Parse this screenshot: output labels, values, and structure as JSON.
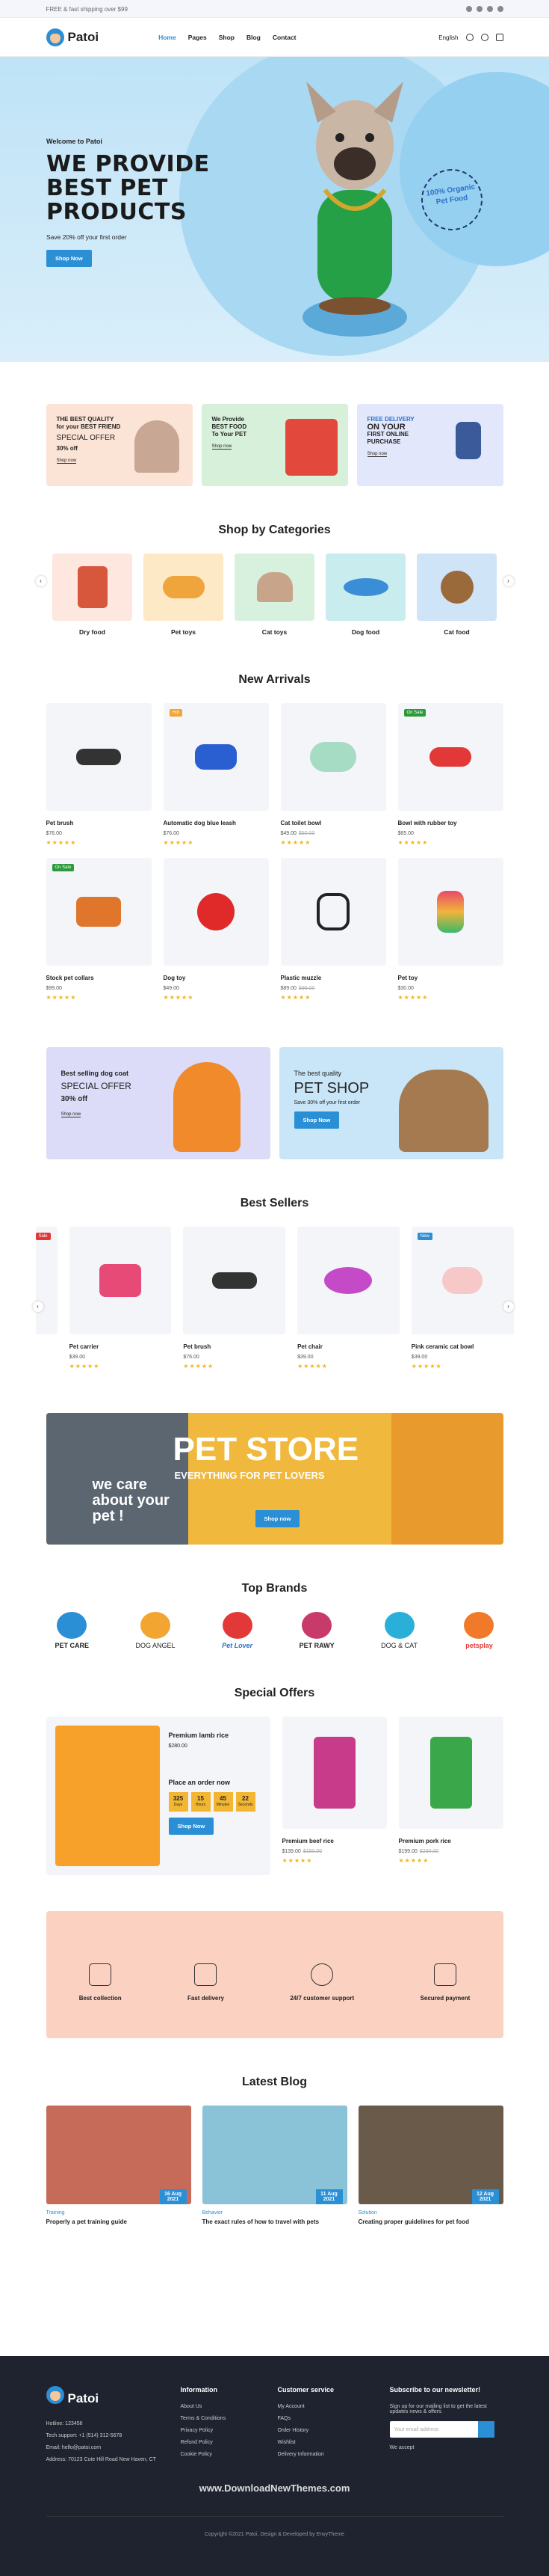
{
  "topbar": {
    "shipping": "FREE & fast shipping over $99"
  },
  "header": {
    "brand": "Patoi",
    "nav": [
      "Home",
      "Pages",
      "Shop",
      "Blog",
      "Contact"
    ],
    "lang": "English"
  },
  "hero": {
    "welcome": "Welcome to Patoi",
    "title": "We provide best pet products",
    "save": "Save 20% off your first order",
    "button": "Shop Now",
    "badge": "100% Organic Pet Food"
  },
  "promos": [
    {
      "l1": "THE BEST QUALITY",
      "l2": "for your BEST FRIEND",
      "l3": "SPECIAL OFFER",
      "l4": "30% off",
      "link": "Shop now"
    },
    {
      "l1": "We Provide",
      "l2": "BEST FOOD",
      "l3": "To Your PET",
      "l4": "",
      "link": "Shop now"
    },
    {
      "l1": "FREE DELIVERY",
      "l2": "ON YOUR",
      "l3": "FIRST ONLINE",
      "l4": "PURCHASE",
      "link": "Shop now"
    }
  ],
  "categories": {
    "title": "Shop by Categories",
    "items": [
      "Dry food",
      "Pet toys",
      "Cat toys",
      "Dog food",
      "Cat food"
    ]
  },
  "arrivals": {
    "title": "New Arrivals",
    "items": [
      {
        "name": "Pet brush",
        "price": "$76.00",
        "old": "",
        "tag": ""
      },
      {
        "name": "Automatic dog blue leash",
        "price": "$76.00",
        "old": "",
        "tag": "Hot"
      },
      {
        "name": "Cat toilet bowl",
        "price": "$49.00",
        "old": "$50.00",
        "tag": ""
      },
      {
        "name": "Bowl with rubber toy",
        "price": "$65.00",
        "old": "",
        "tag": "On Sale"
      },
      {
        "name": "Stock pet collars",
        "price": "$99.00",
        "old": "",
        "tag": "On Sale"
      },
      {
        "name": "Dog toy",
        "price": "$49.00",
        "old": "",
        "tag": ""
      },
      {
        "name": "Plastic muzzle",
        "price": "$89.00",
        "old": "$96.00",
        "tag": ""
      },
      {
        "name": "Pet toy",
        "price": "$30.00",
        "old": "",
        "tag": ""
      }
    ]
  },
  "banners": [
    {
      "l1": "Best selling dog coat",
      "l2": "SPECIAL OFFER",
      "l3": "30% off",
      "link": "Shop now"
    },
    {
      "l1": "The best quality",
      "l2": "PET SHOP",
      "l3": "Save 30% off your first order",
      "link": "Shop Now"
    }
  ],
  "sellers": {
    "title": "Best Sellers",
    "items": [
      {
        "name": "Pet carrier",
        "price": "$39.00",
        "tag": ""
      },
      {
        "name": "Pet brush",
        "price": "$76.00",
        "tag": ""
      },
      {
        "name": "Pet chair",
        "price": "$39.00",
        "tag": ""
      },
      {
        "name": "Pink ceramic cat bowl",
        "price": "$39.00",
        "tag": "New"
      }
    ]
  },
  "petstore": {
    "title": "PET STORE",
    "sub": "EVERYTHING FOR PET LOVERS",
    "care": "we care about your pet !",
    "button": "Shop now"
  },
  "brands": {
    "title": "Top Brands",
    "items": [
      "PET CARE",
      "DOG ANGEL",
      "Pet Lover",
      "PET RAWY",
      "DOG & CAT",
      "petsplay"
    ]
  },
  "offers": {
    "title": "Special Offers",
    "featured": {
      "name": "Premium lamb rice",
      "price": "$280.00",
      "hurry": "Place an order now",
      "cd": [
        {
          "v": "325",
          "u": "Days"
        },
        {
          "v": "15",
          "u": "Hours"
        },
        {
          "v": "45",
          "u": "Minutes"
        },
        {
          "v": "22",
          "u": "Seconds"
        }
      ],
      "button": "Shop Now"
    },
    "items": [
      {
        "name": "Premium beef rice",
        "price": "$139.00",
        "old": "$150.00"
      },
      {
        "name": "Premium pork rice",
        "price": "$199.00",
        "old": "$230.00"
      }
    ]
  },
  "features": [
    "Best collection",
    "Fast delivery",
    "24/7 customer support",
    "Secured payment"
  ],
  "blog": {
    "title": "Latest Blog",
    "posts": [
      {
        "cat": "Training",
        "title": "Properly a pet training guide",
        "date": "16 Aug",
        "year": "2021"
      },
      {
        "cat": "Behavior",
        "title": "The exact rules of how to travel with pets",
        "date": "11 Aug",
        "year": "2021"
      },
      {
        "cat": "Solution",
        "title": "Creating proper guidelines for pet food",
        "date": "12 Aug",
        "year": "2021"
      }
    ]
  },
  "footer": {
    "hotline": "Hotline: 123456",
    "support": "Tech support: +1 (514) 312-5678",
    "email": "Email: hello@patoi.com",
    "address": "Address: 70123 Cute Hill Road New Haven, CT",
    "info_title": "Information",
    "info": [
      "About Us",
      "Terms & Conditions",
      "Privacy Policy",
      "Refund Policy",
      "Cookie Policy"
    ],
    "cs_title": "Customer service",
    "cs": [
      "My Account",
      "FAQs",
      "Order History",
      "Wishlist",
      "Delivery Information"
    ],
    "sub_title": "Subscribe to our newsletter!",
    "sub_text": "Sign up for our mailing list to get the latest updates news & offers.",
    "placeholder": "Your email address",
    "accept": "We accept",
    "watermark": "www.DownloadNewThemes.com",
    "copy": "Copyright ©2021 Patoi. Design & Developed by EnvyTheme"
  }
}
